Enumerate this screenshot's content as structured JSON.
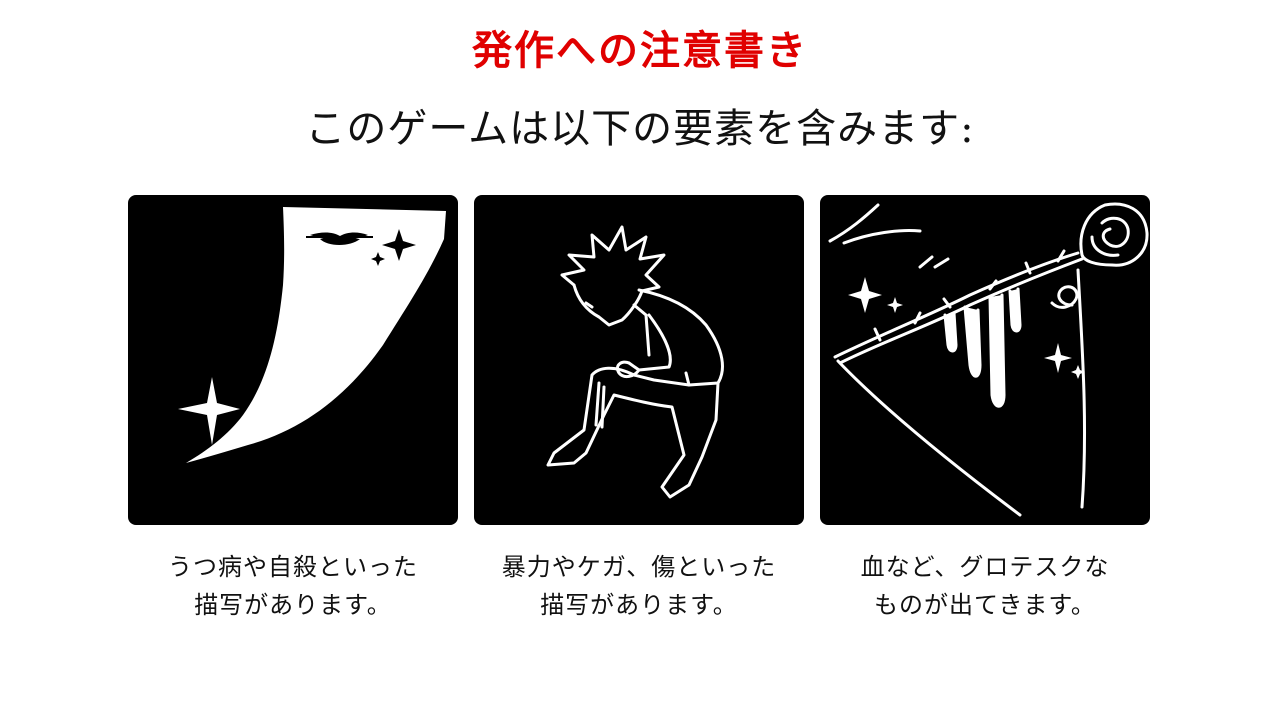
{
  "header": {
    "title": "発作への注意書き",
    "subtitle": "このゲームは以下の要素を含みます:"
  },
  "warnings": [
    {
      "icon": "curtain-sparkle-icon",
      "line1": "うつ病や自殺といった",
      "line2": "描写があります。"
    },
    {
      "icon": "crouching-person-icon",
      "line1": "暴力やケガ、傷といった",
      "line2": "描写があります。"
    },
    {
      "icon": "thorny-rose-blood-icon",
      "line1": "血など、グロテスクな",
      "line2": "ものが出てきます。"
    }
  ],
  "colors": {
    "title": "#e00000",
    "panel": "#000000",
    "line_art": "#ffffff",
    "text": "#111111"
  }
}
